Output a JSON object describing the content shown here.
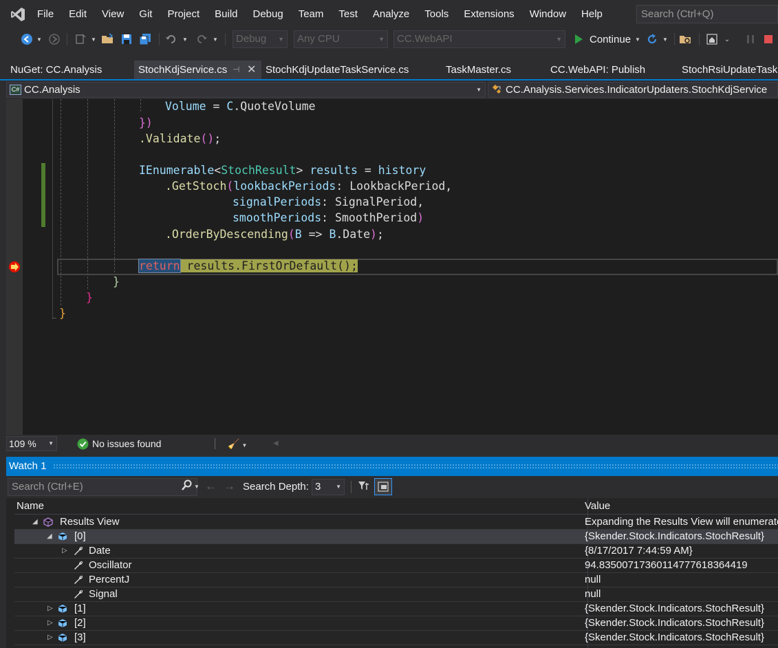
{
  "menu": {
    "items": [
      "File",
      "Edit",
      "View",
      "Git",
      "Project",
      "Build",
      "Debug",
      "Team",
      "Test",
      "Analyze",
      "Tools",
      "Extensions",
      "Window",
      "Help"
    ],
    "search_placeholder": "Search (Ctrl+Q)"
  },
  "toolbar": {
    "config": "Debug",
    "platform": "Any CPU",
    "startup_project": "CC.WebAPI",
    "continue_label": "Continue"
  },
  "tabs": [
    {
      "label": "NuGet: CC.Analysis",
      "active": false
    },
    {
      "label": "StochKdjService.cs",
      "active": true
    },
    {
      "label": "StochKdjUpdateTaskService.cs",
      "active": false
    },
    {
      "label": "TaskMaster.cs",
      "active": false
    },
    {
      "label": "CC.WebAPI: Publish",
      "active": false
    },
    {
      "label": "StochRsiUpdateTask.c",
      "active": false
    }
  ],
  "navbar": {
    "project": "CC.Analysis",
    "type": "CC.Analysis.Services.IndicatorUpdaters.StochKdjService",
    "lang_badge": "C#"
  },
  "code": {
    "l1_volume": "Volume",
    "l1_eq": " = ",
    "l1_c": "C",
    "l1_rest": ".QuoteVolume",
    "l2": "})",
    "l3_validate": ".Validate",
    "l3_rest": "();",
    "l5_type": "IEnumerable",
    "l5_generic": "StochResult",
    "l5_results": "results",
    "l5_history": "history",
    "l6_method": ".GetStoch",
    "l6_param": "lookbackPeriods",
    "l6_val": "LookbackPeriod,",
    "l7_param": "signalPeriods",
    "l7_val": "SignalPeriod,",
    "l8_param": "smoothPeriods",
    "l8_val": "SmoothPeriod",
    "l9_method": ".OrderByDescending",
    "l9_b": "B",
    "l9_arrow": " => ",
    "l9_b2": "B",
    "l9_date": ".Date",
    "l11_return": "return",
    "l11_stmt": " results.FirstOrDefault();",
    "brace_close": "}"
  },
  "editor_status": {
    "zoom": "109 %",
    "issues": "No issues found"
  },
  "watch": {
    "title": "Watch 1",
    "search_placeholder": "Search (Ctrl+E)",
    "search_depth_label": "Search Depth:",
    "search_depth_value": "3",
    "columns": {
      "name": "Name",
      "value": "Value"
    },
    "rows": [
      {
        "name": "Results View",
        "value": "Expanding the Results View will enumerate",
        "icon": "results-view-icon"
      },
      {
        "name": "[0]",
        "value": "{Skender.Stock.Indicators.StochResult}",
        "icon": "object-icon"
      },
      {
        "name": "Date",
        "value": "{8/17/2017 7:44:59 AM}",
        "icon": "property-wrench-icon"
      },
      {
        "name": "Oscillator",
        "value": "94.8350071736011477761836441​9",
        "icon": "property-wrench-icon"
      },
      {
        "name": "PercentJ",
        "value": "null",
        "icon": "property-wrench-icon"
      },
      {
        "name": "Signal",
        "value": "null",
        "icon": "property-wrench-icon"
      },
      {
        "name": "[1]",
        "value": "{Skender.Stock.Indicators.StochResult}",
        "icon": "object-icon"
      },
      {
        "name": "[2]",
        "value": "{Skender.Stock.Indicators.StochResult}",
        "icon": "object-icon"
      },
      {
        "name": "[3]",
        "value": "{Skender.Stock.Indicators.StochResult}",
        "icon": "object-icon"
      }
    ]
  },
  "colors": {
    "accent": "#007acc",
    "editor_bg": "#1e1e1e",
    "chrome_bg": "#2d2d30"
  }
}
